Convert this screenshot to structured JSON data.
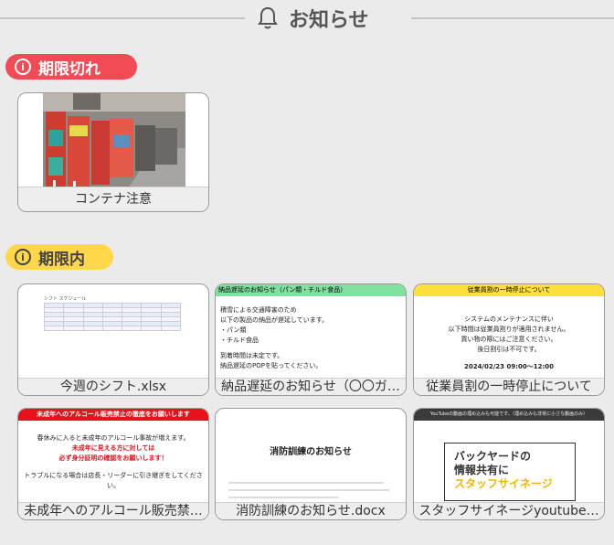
{
  "header": {
    "title": "お知らせ",
    "icon": "bell-icon"
  },
  "sections": {
    "expired": {
      "label": "期限切れ",
      "icon": "info-icon",
      "color": "#f24b55"
    },
    "active": {
      "label": "期限内",
      "icon": "info-icon",
      "color": "#ffd84a"
    }
  },
  "expired_items": [
    {
      "caption": "コンテナ注意"
    }
  ],
  "active_items": [
    {
      "caption": "今週のシフト.xlsx",
      "preview": {
        "sheet_title": "シフト スケジュール"
      }
    },
    {
      "caption": "納品遅延のお知らせ（〇〇ガ…",
      "preview": {
        "header": "納品遅延のお知らせ（パン類・チルド食品）",
        "lines": [
          "積雪による交通障害のため",
          "以下の製品の納品が遅延しています。",
          "・パン類",
          "・チルド食品",
          "到着時間は未定です。",
          "納品遅延のPOPを貼ってください。"
        ]
      }
    },
    {
      "caption": "従業員割の一時停止について",
      "preview": {
        "header": "従業員割の一時停止について",
        "lines": [
          "システムのメンテナンスに伴い",
          "以下時間は従業員割りが適用されません。",
          "買い物の際にはご注意ください。",
          "後日割引は不可です。"
        ],
        "datetime": "2024/02/23 09:00～12:00"
      }
    },
    {
      "caption": "未成年へのアルコール販売禁…",
      "preview": {
        "header": "未成年へのアルコール販売禁止の徹底をお願いします",
        "line1": "春休みに入ると未成年のアルコール事故が増えます。",
        "red1": "未成年に見える方に対しては",
        "red2": "必ず身分証明の確認をお願いします！",
        "line2": "トラブルになる場合は店長・リーダーに引き継ぎをしてください。"
      }
    },
    {
      "caption": "消防訓練のお知らせ.docx",
      "preview": {
        "title": "消防訓練のお知らせ"
      }
    },
    {
      "caption": "スタッフサイネージyoutube…",
      "preview": {
        "bar": "YouTubeの動画の埋め込みも可能です。（埋め込みも非常に小さな動画のみ）",
        "sign1": "バックヤードの",
        "sign2": "情報共有に",
        "sign3": "スタッフサイネージ"
      }
    }
  ]
}
